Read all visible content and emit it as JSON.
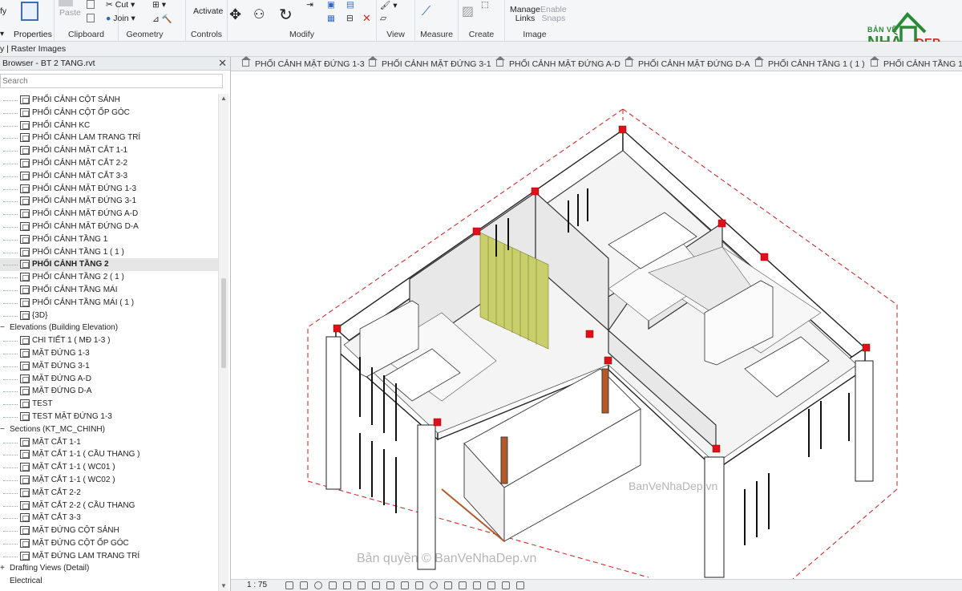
{
  "ribbon": {
    "edge_label": "fy",
    "properties_label": "Properties",
    "clipboard": {
      "group": "Clipboard",
      "paste": "Paste",
      "cut": "Cut",
      "join": "Join"
    },
    "geometry_label": "Geometry",
    "controls": {
      "group": "Controls",
      "activate": "Activate"
    },
    "modify_label": "Modify",
    "view_label": "View",
    "measure_label": "Measure",
    "create_label": "Create",
    "image": {
      "group": "Image",
      "manage_links": "Manage\nLinks",
      "enable_snaps": "Enable\nSnaps"
    }
  },
  "context_bar": "y | Raster Images",
  "browser": {
    "title": "Browser - BT 2 TANG.rvt",
    "close": "✕",
    "search_placeholder": "Search",
    "items": [
      {
        "label": "PHỐI CẢNH CỘT SẢNH",
        "kind": "view"
      },
      {
        "label": "PHỐI CẢNH CỘT ỐP GÓC",
        "kind": "view"
      },
      {
        "label": "PHỐI CẢNH KC",
        "kind": "view"
      },
      {
        "label": "PHỐI CẢNH LAM TRANG TRÍ",
        "kind": "view"
      },
      {
        "label": "PHỐI CẢNH MẶT CẮT 1-1",
        "kind": "view"
      },
      {
        "label": "PHỐI CẢNH MẶT CẮT 2-2",
        "kind": "view"
      },
      {
        "label": "PHỐI CẢNH MẶT CẮT 3-3",
        "kind": "view"
      },
      {
        "label": "PHỐI CẢNH MẶT ĐỨNG 1-3",
        "kind": "view"
      },
      {
        "label": "PHỐI CẢNH MẶT ĐỨNG 3-1",
        "kind": "view"
      },
      {
        "label": "PHỐI CẢNH MẶT ĐỨNG A-D",
        "kind": "view"
      },
      {
        "label": "PHỐI CẢNH MẶT ĐỨNG D-A",
        "kind": "view"
      },
      {
        "label": "PHỐI CẢNH TẦNG 1",
        "kind": "view"
      },
      {
        "label": "PHỐI CẢNH TẦNG 1 ( 1 )",
        "kind": "view"
      },
      {
        "label": "PHỐI CẢNH TẦNG 2",
        "kind": "view",
        "selected": true
      },
      {
        "label": "PHỐI CẢNH TẦNG 2 ( 1 )",
        "kind": "view"
      },
      {
        "label": "PHỐI CẢNH TẦNG MÁI",
        "kind": "view"
      },
      {
        "label": "PHỐI CẢNH TẦNG MÁI ( 1 )",
        "kind": "view"
      },
      {
        "label": "{3D}",
        "kind": "view"
      },
      {
        "label": "Elevations (Building Elevation)",
        "kind": "group",
        "toggle": "−"
      },
      {
        "label": "CHI TIẾT 1 ( MĐ 1-3 )",
        "kind": "view"
      },
      {
        "label": "MẶT ĐỨNG 1-3",
        "kind": "view"
      },
      {
        "label": "MẶT ĐỨNG 3-1",
        "kind": "view"
      },
      {
        "label": "MẶT ĐỨNG A-D",
        "kind": "view"
      },
      {
        "label": "MẶT ĐỨNG D-A",
        "kind": "view"
      },
      {
        "label": "TEST",
        "kind": "view"
      },
      {
        "label": "TEST MẶT ĐỨNG 1-3",
        "kind": "view"
      },
      {
        "label": "Sections (KT_MC_CHINH)",
        "kind": "group",
        "toggle": "−"
      },
      {
        "label": "MẶT CẮT 1-1",
        "kind": "view"
      },
      {
        "label": "MẶT CẮT 1-1 ( CẦU THANG )",
        "kind": "view"
      },
      {
        "label": "MẶT CẮT 1-1 ( WC01 )",
        "kind": "view"
      },
      {
        "label": "MẶT CẮT 1-1 ( WC02 )",
        "kind": "view"
      },
      {
        "label": "MẶT CẮT 2-2",
        "kind": "view"
      },
      {
        "label": "MẶT CẮT 2-2 ( CẦU THANG",
        "kind": "view"
      },
      {
        "label": "MẶT CẮT 3-3",
        "kind": "view"
      },
      {
        "label": "MẶT ĐỨNG CỘT SẢNH",
        "kind": "view"
      },
      {
        "label": "MẶT ĐỨNG CỘT ỐP GÓC",
        "kind": "view"
      },
      {
        "label": "MẶT ĐỨNG LAM TRANG TRÍ",
        "kind": "view"
      },
      {
        "label": "Drafting Views (Detail)",
        "kind": "group",
        "toggle": "+"
      },
      {
        "label": "Electrical",
        "kind": "group",
        "toggle": ""
      }
    ]
  },
  "tabs": [
    "PHỐI CẢNH MẶT ĐỨNG 1-3",
    "PHỐI CẢNH MẶT ĐỨNG 3-1",
    "PHỐI CẢNH MẶT ĐỨNG A-D",
    "PHỐI CẢNH MẶT ĐỨNG D-A",
    "PHỐI CẢNH TẦNG 1 ( 1 )",
    "PHỐI CẢNH TẦNG 1"
  ],
  "status": {
    "scale": "1 : 75"
  },
  "logo": {
    "top": "BẢN VẼ",
    "main": "NHÀ",
    "accent": "ĐẸP"
  },
  "watermarks": [
    "BanVeNhaDep.vn",
    "Bản quyền © BanVeNhaDep.vn"
  ],
  "colors": {
    "brand_green": "#2a8a36",
    "brand_red": "#d02a2a",
    "marker_red": "#e0101a",
    "lamella": "#c9cf6b"
  }
}
